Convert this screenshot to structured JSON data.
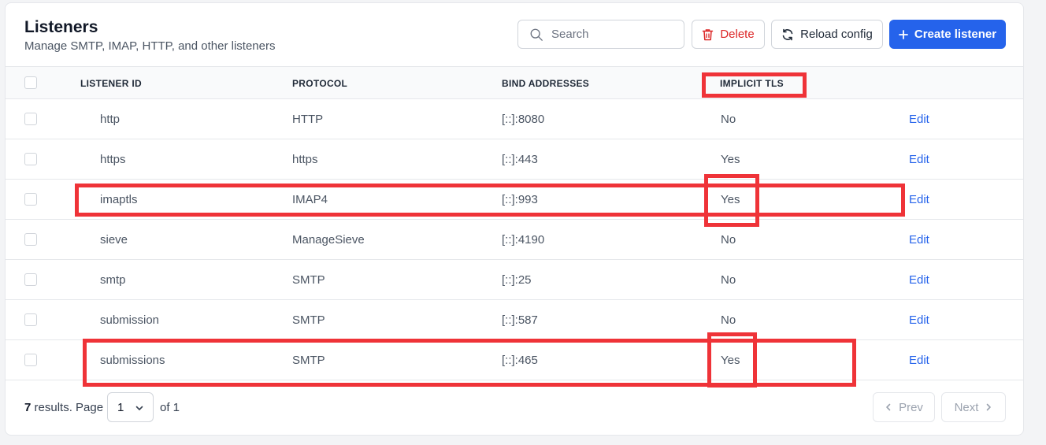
{
  "header": {
    "title": "Listeners",
    "subtitle": "Manage SMTP, IMAP, HTTP, and other listeners"
  },
  "toolbar": {
    "search_placeholder": "Search",
    "delete_label": "Delete",
    "reload_label": "Reload config",
    "create_label": "Create listener",
    "accent_color": "#2563eb",
    "danger_color": "#dc2626"
  },
  "table": {
    "columns": [
      "LISTENER ID",
      "PROTOCOL",
      "BIND ADDRESSES",
      "IMPLICIT TLS"
    ],
    "rows": [
      {
        "id": "http",
        "protocol": "HTTP",
        "bind": "[::]:8080",
        "tls": "No",
        "action": "Edit"
      },
      {
        "id": "https",
        "protocol": "https",
        "bind": "[::]:443",
        "tls": "Yes",
        "action": "Edit"
      },
      {
        "id": "imaptls",
        "protocol": "IMAP4",
        "bind": "[::]:993",
        "tls": "Yes",
        "action": "Edit"
      },
      {
        "id": "sieve",
        "protocol": "ManageSieve",
        "bind": "[::]:4190",
        "tls": "No",
        "action": "Edit"
      },
      {
        "id": "smtp",
        "protocol": "SMTP",
        "bind": "[::]:25",
        "tls": "No",
        "action": "Edit"
      },
      {
        "id": "submission",
        "protocol": "SMTP",
        "bind": "[::]:587",
        "tls": "No",
        "action": "Edit"
      },
      {
        "id": "submissions",
        "protocol": "SMTP",
        "bind": "[::]:465",
        "tls": "Yes",
        "action": "Edit"
      }
    ]
  },
  "footer": {
    "results_count": "7",
    "results_suffix": " results. Page",
    "page_value": "1",
    "of_text": "of 1",
    "prev_label": "Prev",
    "next_label": "Next"
  },
  "annotation_color": "#ef3338"
}
